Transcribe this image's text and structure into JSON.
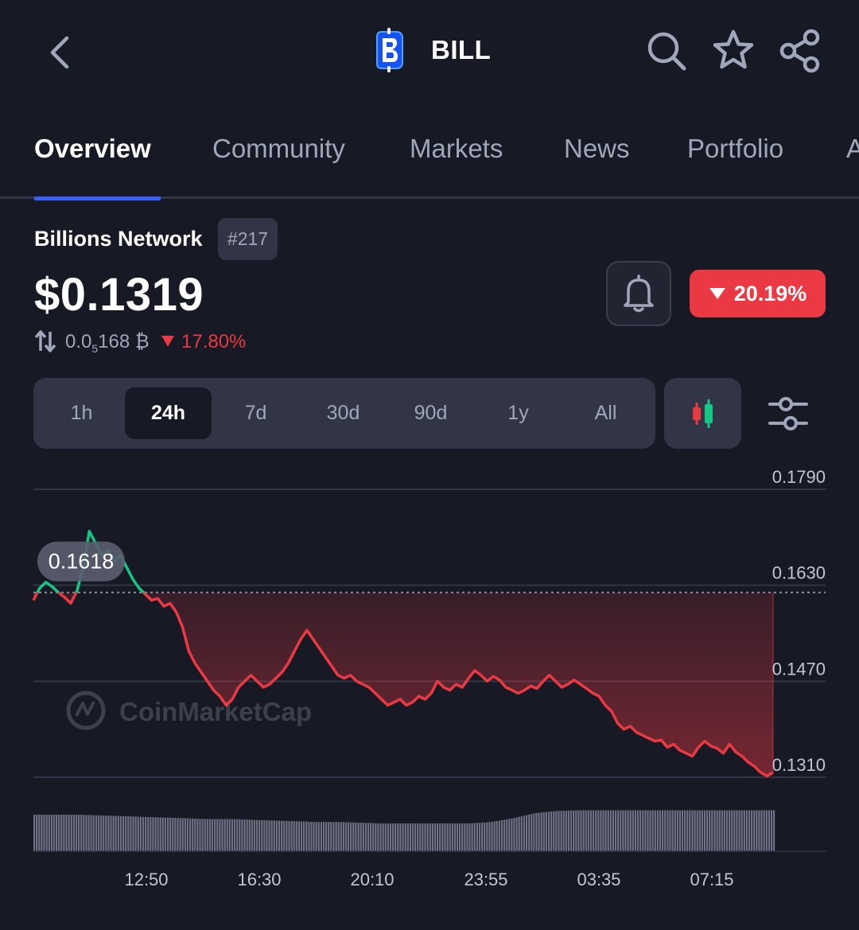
{
  "header": {
    "symbol": "BILL",
    "logo_icon": "bill-coin-logo",
    "icons": [
      "back-icon",
      "search-icon",
      "star-icon",
      "share-icon"
    ]
  },
  "tabs": [
    {
      "label": "Overview",
      "active": true
    },
    {
      "label": "Community",
      "active": false
    },
    {
      "label": "Markets",
      "active": false
    },
    {
      "label": "News",
      "active": false
    },
    {
      "label": "Portfolio",
      "active": false
    },
    {
      "label": "A",
      "active": false
    }
  ],
  "coin": {
    "name": "Billions Network",
    "rank": "#217",
    "price": "$0.1319",
    "btc_price_main": "0.0",
    "btc_price_sub": "5",
    "btc_price_rest": "168 ₿",
    "btc_change": "17.80%",
    "change_24h": "20.19%"
  },
  "range": {
    "options": [
      "1h",
      "24h",
      "7d",
      "30d",
      "90d",
      "1y",
      "All"
    ],
    "selected": "24h"
  },
  "colors": {
    "background": "#171924",
    "accent": "#3861fb",
    "down": "#ea3943",
    "up": "#16c784"
  },
  "chart_data": {
    "type": "line",
    "y_ticks": [
      "0.1790",
      "0.1630",
      "0.1470",
      "0.1310"
    ],
    "ylim": [
      0.131,
      0.179
    ],
    "x_ticks": [
      "12:50",
      "16:30",
      "20:10",
      "23:55",
      "03:35",
      "07:15"
    ],
    "reference_value": "0.1618",
    "watermark": "CoinMarketCap",
    "series": [
      {
        "values": [
          0.1605,
          0.1625,
          0.1635,
          0.1628,
          0.1618,
          0.161,
          0.16,
          0.162,
          0.166,
          0.172,
          0.17,
          0.168,
          0.169,
          0.167,
          0.168,
          0.166,
          0.164,
          0.1625,
          0.1615,
          0.1605,
          0.1608,
          0.1595,
          0.16,
          0.1585,
          0.156,
          0.152,
          0.15,
          0.1485,
          0.147,
          0.1455,
          0.1445,
          0.143,
          0.144,
          0.146,
          0.147,
          0.148,
          0.147,
          0.146,
          0.1465,
          0.1475,
          0.1485,
          0.15,
          0.152,
          0.154,
          0.1555,
          0.154,
          0.1525,
          0.151,
          0.1495,
          0.148,
          0.1475,
          0.148,
          0.147,
          0.1465,
          0.146,
          0.145,
          0.144,
          0.143,
          0.1435,
          0.144,
          0.143,
          0.1435,
          0.1445,
          0.144,
          0.145,
          0.147,
          0.146,
          0.1455,
          0.1465,
          0.146,
          0.1475,
          0.1488,
          0.148,
          0.147,
          0.1478,
          0.1472,
          0.146,
          0.1455,
          0.145,
          0.1455,
          0.1462,
          0.1458,
          0.147,
          0.148,
          0.147,
          0.146,
          0.1465,
          0.1472,
          0.1465,
          0.1458,
          0.145,
          0.1445,
          0.143,
          0.142,
          0.14,
          0.139,
          0.1395,
          0.1385,
          0.138,
          0.1375,
          0.137,
          0.1372,
          0.136,
          0.1365,
          0.1355,
          0.135,
          0.1345,
          0.136,
          0.137,
          0.1362,
          0.1358,
          0.135,
          0.1365,
          0.1352,
          0.1345,
          0.1335,
          0.1328,
          0.1318,
          0.1312,
          0.1318
        ],
        "above_reference_color": "#16c784",
        "below_reference_color": "#ea3943"
      }
    ],
    "volume": [
      0.5,
      0.5,
      0.5,
      0.49,
      0.48,
      0.47,
      0.46,
      0.45,
      0.44,
      0.44,
      0.43,
      0.42,
      0.41,
      0.4,
      0.4,
      0.39,
      0.38,
      0.38,
      0.38,
      0.38,
      0.38,
      0.4,
      0.45,
      0.52,
      0.55,
      0.56,
      0.56,
      0.56,
      0.56,
      0.56,
      0.56,
      0.56,
      0.56,
      0.56,
      0.56
    ],
    "grid": true
  }
}
